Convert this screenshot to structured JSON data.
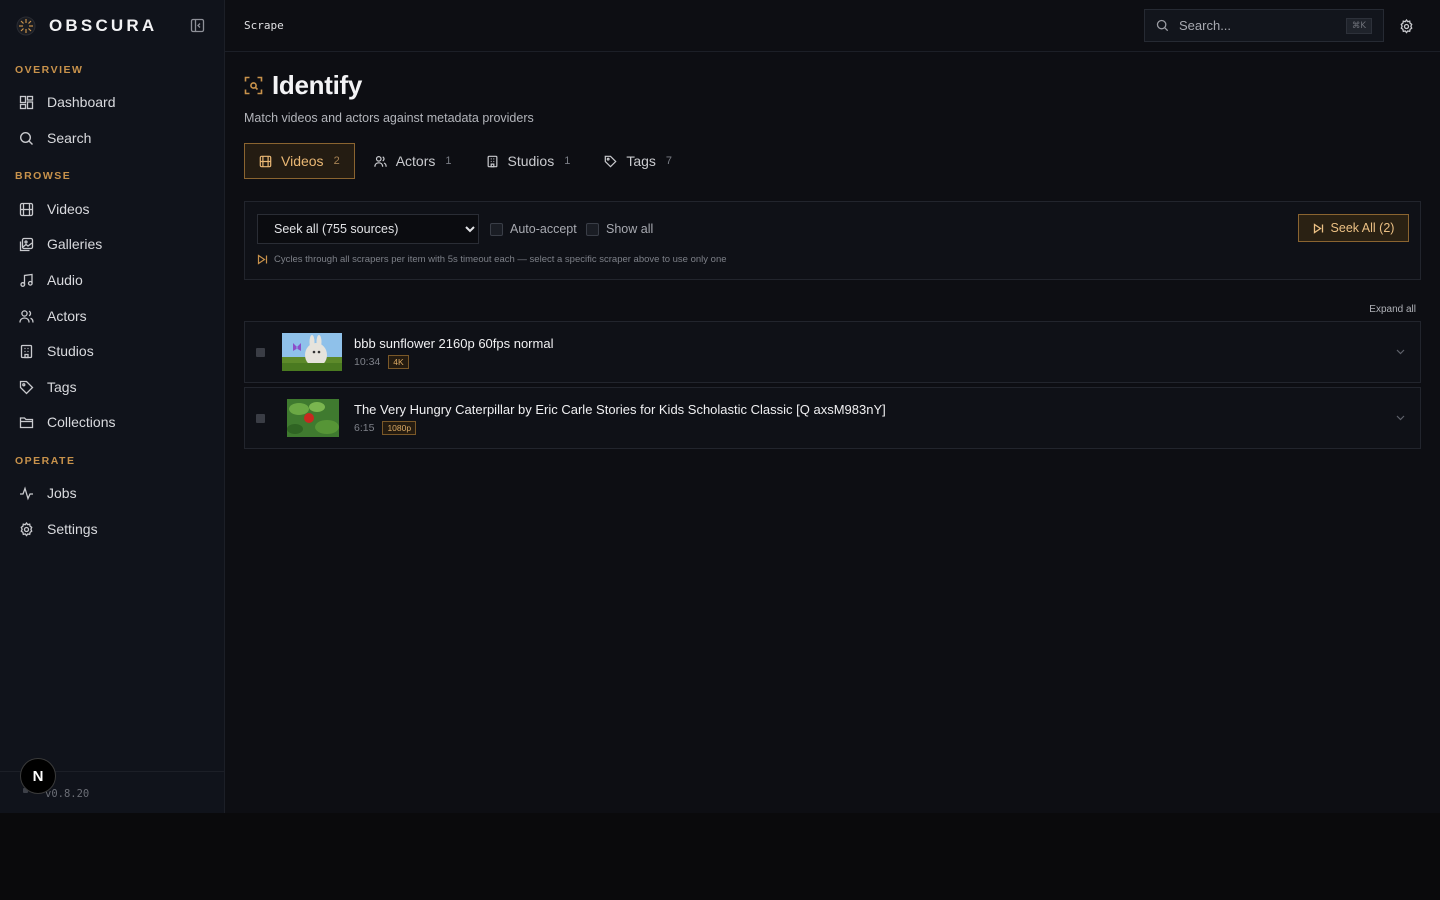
{
  "brand": {
    "name": "OBSCURA",
    "version": "v0.8.20",
    "avatar_letter": "N"
  },
  "sidebar": {
    "sections": [
      {
        "label": "OVERVIEW",
        "items": [
          {
            "label": "Dashboard",
            "icon": "dashboard-icon"
          },
          {
            "label": "Search",
            "icon": "search-icon"
          }
        ]
      },
      {
        "label": "BROWSE",
        "items": [
          {
            "label": "Videos",
            "icon": "film-icon"
          },
          {
            "label": "Galleries",
            "icon": "gallery-icon"
          },
          {
            "label": "Audio",
            "icon": "music-icon"
          },
          {
            "label": "Actors",
            "icon": "users-icon"
          },
          {
            "label": "Studios",
            "icon": "building-icon"
          },
          {
            "label": "Tags",
            "icon": "tag-icon"
          },
          {
            "label": "Collections",
            "icon": "folder-icon"
          }
        ]
      },
      {
        "label": "OPERATE",
        "items": [
          {
            "label": "Jobs",
            "icon": "activity-icon"
          },
          {
            "label": "Settings",
            "icon": "gear-icon"
          }
        ]
      }
    ]
  },
  "topbar": {
    "breadcrumb": "Scrape",
    "search_placeholder": "Search...",
    "shortcut": "⌘K"
  },
  "page": {
    "title": "Identify",
    "subtitle": "Match videos and actors against metadata providers"
  },
  "tabs": [
    {
      "label": "Videos",
      "count": "2",
      "active": true
    },
    {
      "label": "Actors",
      "count": "1",
      "active": false
    },
    {
      "label": "Studios",
      "count": "1",
      "active": false
    },
    {
      "label": "Tags",
      "count": "7",
      "active": false
    }
  ],
  "controls": {
    "scraper_selected": "Seek all (755 sources)",
    "auto_accept_label": "Auto-accept",
    "show_all_label": "Show all",
    "seek_all_label": "Seek All (2)",
    "hint": "Cycles through all scrapers per item with 5s timeout each — select a specific scraper above to use only one"
  },
  "list": {
    "expand_all_label": "Expand all",
    "videos": [
      {
        "title": "bbb sunflower 2160p 60fps normal",
        "duration": "10:34",
        "resolution": "4K"
      },
      {
        "title": "The Very Hungry Caterpillar by Eric Carle Stories for Kids Scholastic Classic [Q axsM983nY]",
        "duration": "6:15",
        "resolution": "1080p"
      }
    ]
  },
  "colors": {
    "accent": "#c8924b",
    "background": "#0d0e13",
    "sidebar": "#10131b"
  }
}
